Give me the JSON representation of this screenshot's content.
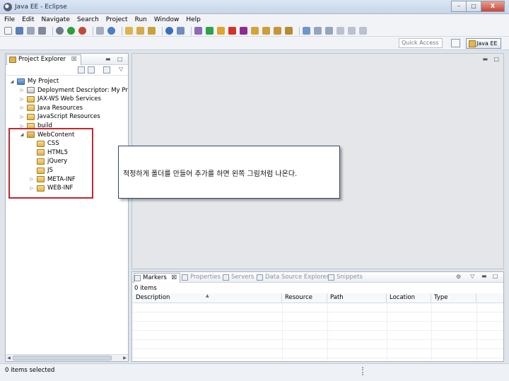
{
  "window": {
    "title": "Java EE - Eclipse",
    "min": "–",
    "max": "□",
    "close": "X"
  },
  "menu": [
    "File",
    "Edit",
    "Navigate",
    "Search",
    "Project",
    "Run",
    "Window",
    "Help"
  ],
  "toolbar": {
    "quick_access_placeholder": "Quick Access",
    "perspective": "Java EE"
  },
  "explorer": {
    "tab_label": "Project Explorer",
    "tab_close": "☒",
    "tree": [
      {
        "label": "My Project",
        "depth": 0,
        "expanded": true,
        "icon": "project-icon"
      },
      {
        "label": "Deployment Descriptor: My Proje",
        "depth": 1,
        "expanded": false,
        "icon": "descriptor-icon"
      },
      {
        "label": "JAX-WS Web Services",
        "depth": 1,
        "expanded": false,
        "icon": "webservice-icon"
      },
      {
        "label": "Java Resources",
        "depth": 1,
        "expanded": false,
        "icon": "java-resources-icon"
      },
      {
        "label": "JavaScript Resources",
        "depth": 1,
        "expanded": false,
        "icon": "js-resources-icon"
      },
      {
        "label": "build",
        "depth": 1,
        "expanded": false,
        "icon": "folder-icon"
      },
      {
        "label": "WebContent",
        "depth": 1,
        "expanded": true,
        "icon": "folder-open-icon"
      },
      {
        "label": "CSS",
        "depth": 2,
        "expanded": null,
        "icon": "folder-icon"
      },
      {
        "label": "HTML5",
        "depth": 2,
        "expanded": null,
        "icon": "folder-icon"
      },
      {
        "label": "jQuery",
        "depth": 2,
        "expanded": null,
        "icon": "folder-icon"
      },
      {
        "label": "JS",
        "depth": 2,
        "expanded": null,
        "icon": "folder-icon"
      },
      {
        "label": "META-INF",
        "depth": 2,
        "expanded": false,
        "icon": "folder-icon"
      },
      {
        "label": "WEB-INF",
        "depth": 2,
        "expanded": false,
        "icon": "folder-icon"
      }
    ]
  },
  "callout": {
    "text": "적정하게 폴더를 만들어 추가를 하면 왼쪽 그림처럼 나온다."
  },
  "bottom_panel": {
    "tabs": [
      "Markers",
      "Properties",
      "Servers",
      "Data Source Explorer",
      "Snippets"
    ],
    "item_count": "0 items",
    "columns": [
      "Description",
      "Resource",
      "Path",
      "Location",
      "Type"
    ]
  },
  "status": {
    "text": "0 items selected"
  },
  "colors": {
    "highlight_box": "#c0282d",
    "callout_border": "#34466a"
  }
}
